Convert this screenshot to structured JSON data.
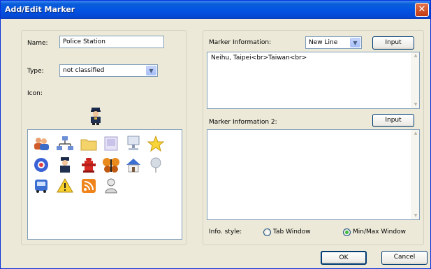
{
  "window": {
    "title": "Add/Edit Marker",
    "close_glyph": "✕"
  },
  "left": {
    "name_label": "Name:",
    "name_value": "Police Station",
    "type_label": "Type:",
    "type_value": "not classified",
    "icon_label": "Icon:",
    "selected_icon": "police-officer-icon",
    "icons": [
      "users-icon",
      "network-icon",
      "folder-icon",
      "document-icon",
      "computer-icon",
      "star-icon",
      "lifebuoy-icon",
      "police-officer-icon",
      "fire-hydrant-icon",
      "butterfly-icon",
      "house-icon",
      "balloon-icon",
      "bus-icon",
      "warning-icon",
      "rss-icon",
      "user-icon"
    ]
  },
  "right": {
    "marker_info_label": "Marker Information:",
    "line_mode_value": "New Line",
    "input_label": "Input",
    "marker_info_value": "Neihu, Taipei<br>Taiwan<br>",
    "marker_info2_label": "Marker Information 2:",
    "input2_label": "Input",
    "marker_info2_value": "",
    "info_style_label": "Info. style:",
    "tab_window_label": "Tab Window",
    "minmax_window_label": "Min/Max Window",
    "selected_style": "minmax"
  },
  "footer": {
    "ok_label": "OK",
    "cancel_label": "Cancel"
  },
  "colors": {
    "title_bar": "#0454e3",
    "window_bg": "#ece9d8",
    "field_border": "#7f9db9"
  }
}
